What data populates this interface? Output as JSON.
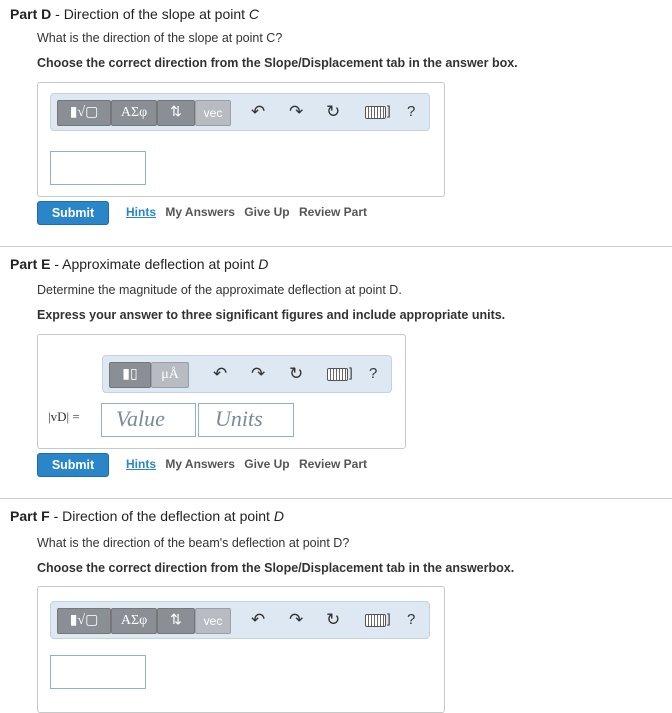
{
  "partD": {
    "label": "Part D",
    "title": "Direction of the slope at point ",
    "title_var": "C",
    "question": "What is the direction of the slope at point C?",
    "instruction": "Choose the correct direction from the Slope/Displacement tab in the answer box.",
    "toolbar": {
      "templates": "▮√▢",
      "greek": "ΑΣφ",
      "arrows": "⇅",
      "vec": "vec",
      "help": "?"
    },
    "submit": "Submit",
    "links": {
      "hints": "Hints",
      "my_answers": "My Answers",
      "give_up": "Give Up",
      "review": "Review Part"
    }
  },
  "partE": {
    "label": "Part E",
    "title": "Approximate deflection at point ",
    "title_var": "D",
    "question": "Determine the magnitude of the approximate deflection at point D.",
    "instruction": "Express your answer to three significant figures and include appropriate units.",
    "toolbar": {
      "templates": "▮▯",
      "units": "μÅ",
      "help": "?"
    },
    "var_label": "|vD| =",
    "value_placeholder": "Value",
    "units_placeholder": "Units",
    "submit": "Submit",
    "links": {
      "hints": "Hints",
      "my_answers": "My Answers",
      "give_up": "Give Up",
      "review": "Review Part"
    }
  },
  "partF": {
    "label": "Part F",
    "title": "Direction of the deflection at point ",
    "title_var": "D",
    "question": "What is the direction of the beam's deflection at point D?",
    "instruction": "Choose the correct direction from the Slope/Displacement tab in the answerbox.",
    "toolbar": {
      "templates": "▮√▢",
      "greek": "ΑΣφ",
      "arrows": "⇅",
      "vec": "vec",
      "help": "?"
    }
  }
}
